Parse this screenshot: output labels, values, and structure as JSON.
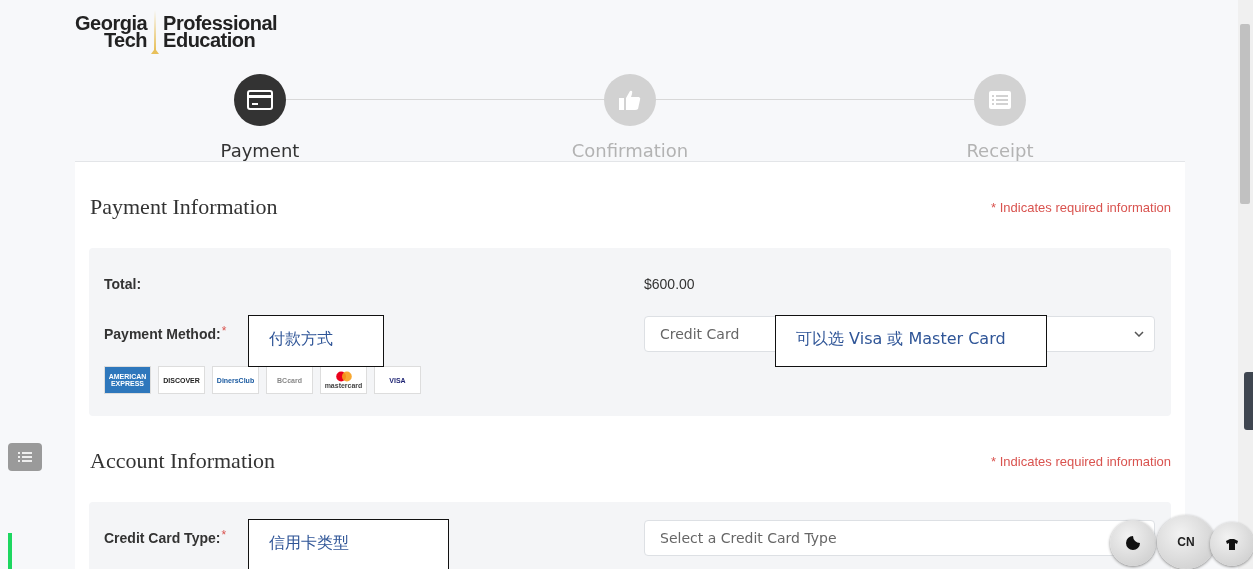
{
  "logo": {
    "left": [
      "Georgia",
      "Tech"
    ],
    "right": [
      "Professional",
      "Education"
    ]
  },
  "steps": [
    {
      "label": "Payment",
      "kind": "card",
      "selected": true
    },
    {
      "label": "Confirmation",
      "kind": "thumb",
      "selected": false
    },
    {
      "label": "Receipt",
      "kind": "list",
      "selected": false
    }
  ],
  "sections": [
    {
      "title": "Payment Information",
      "required_note": "* Indicates required information",
      "rows": [
        {
          "kind": "value",
          "label": "Total:",
          "value": "$600.00"
        },
        {
          "kind": "select",
          "label": "Payment Method:",
          "required_mark": "*",
          "value": "Credit Card",
          "callout_left": "付款方式",
          "callout_right": "可以选 Visa 或 Master Card"
        },
        {
          "kind": "logos",
          "logos": [
            {
              "kind": "amex",
              "text": "AMERICAN EXPRESS"
            },
            {
              "kind": "discover",
              "text": "DISCOVER"
            },
            {
              "kind": "diners",
              "text": "DinersClub"
            },
            {
              "kind": "bc",
              "text": "BCcard"
            },
            {
              "kind": "mastercard",
              "text": "mastercard"
            },
            {
              "kind": "visa",
              "text": "VISA"
            }
          ]
        }
      ]
    },
    {
      "title": "Account Information",
      "required_note": "* Indicates required information",
      "rows": [
        {
          "kind": "select",
          "label": "Credit Card Type:",
          "required_mark": "*",
          "placeholder": "Select a Credit Card Type",
          "callout_left": "信用卡类型"
        }
      ]
    }
  ],
  "ime_widget": {
    "label": "CN"
  }
}
